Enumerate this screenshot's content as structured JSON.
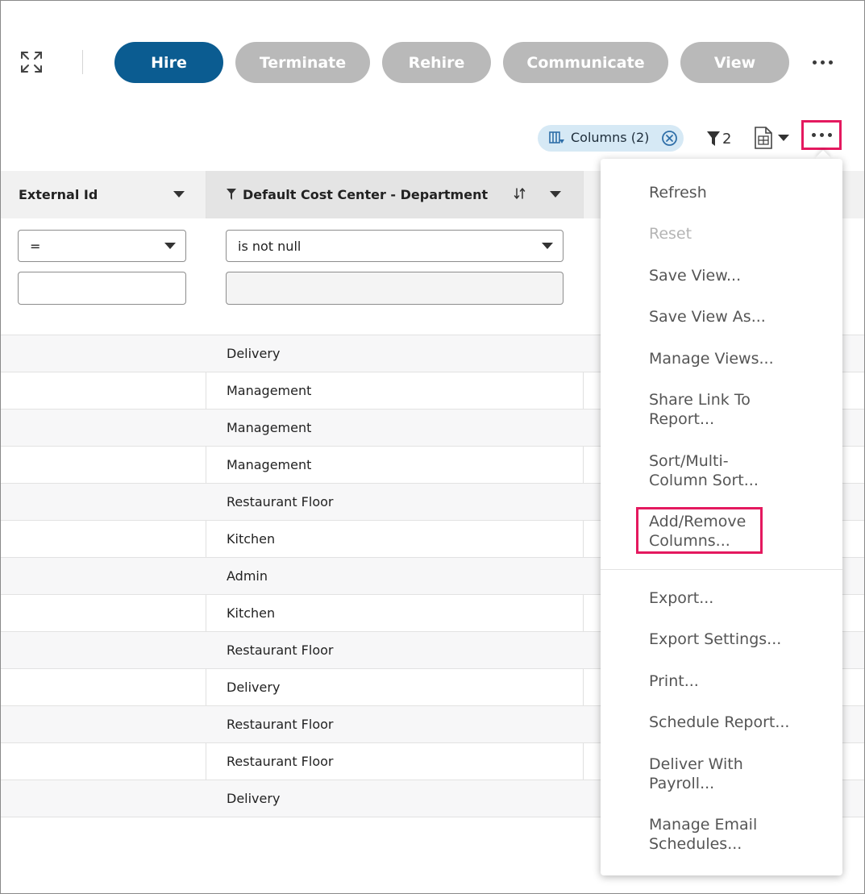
{
  "toolbar": {
    "buttons": [
      {
        "label": "Hire"
      },
      {
        "label": "Terminate"
      },
      {
        "label": "Rehire"
      },
      {
        "label": "Communicate"
      },
      {
        "label": "View"
      }
    ]
  },
  "subbar": {
    "columns_chip_label": "Columns (2)",
    "filter_count": "2"
  },
  "grid": {
    "columns": [
      {
        "label": "External Id"
      },
      {
        "label": "Default Cost Center - Department"
      }
    ],
    "filters": {
      "external_id_operator": "=",
      "external_id_value": "",
      "department_operator": "is not null",
      "department_value": ""
    },
    "rows": [
      {
        "department": "Delivery"
      },
      {
        "department": "Management"
      },
      {
        "department": "Management"
      },
      {
        "department": "Management"
      },
      {
        "department": "Restaurant Floor"
      },
      {
        "department": "Kitchen"
      },
      {
        "department": "Admin"
      },
      {
        "department": "Kitchen"
      },
      {
        "department": "Restaurant Floor"
      },
      {
        "department": "Delivery"
      },
      {
        "department": "Restaurant Floor"
      },
      {
        "department": "Restaurant Floor"
      },
      {
        "department": "Delivery"
      }
    ]
  },
  "menu": {
    "items": [
      {
        "label": "Refresh",
        "disabled": false
      },
      {
        "label": "Reset",
        "disabled": true
      },
      {
        "label": "Save View...",
        "disabled": false
      },
      {
        "label": "Save View As...",
        "disabled": false
      },
      {
        "label": "Manage Views...",
        "disabled": false
      },
      {
        "label": "Share Link To\nReport...",
        "disabled": false
      },
      {
        "label": "Sort/Multi-\nColumn Sort...",
        "disabled": false
      },
      {
        "label": "Add/Remove\nColumns...",
        "disabled": false
      },
      {
        "label": "Export...",
        "disabled": false
      },
      {
        "label": "Export Settings...",
        "disabled": false
      },
      {
        "label": "Print...",
        "disabled": false
      },
      {
        "label": "Schedule Report...",
        "disabled": false
      },
      {
        "label": "Deliver With\nPayroll...",
        "disabled": false
      },
      {
        "label": "Manage Email\nSchedules...",
        "disabled": false
      }
    ]
  },
  "colors": {
    "primary": "#0b5c91",
    "disabled_button": "#b9b9b9",
    "highlight": "#e4195f",
    "chip_background": "#d6e9f5"
  }
}
